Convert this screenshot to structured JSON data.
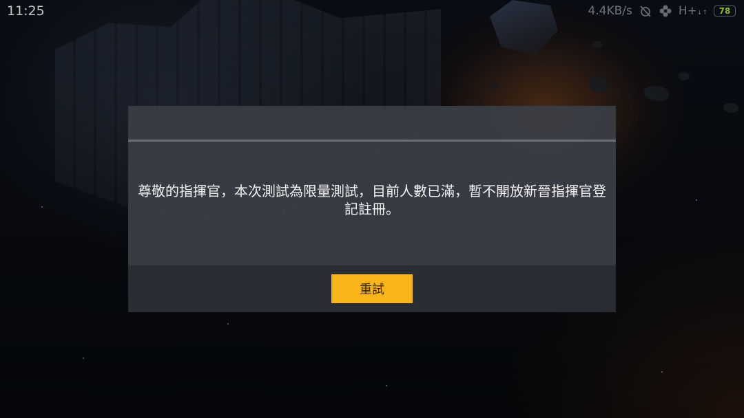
{
  "status_bar": {
    "time": "11:25",
    "network_speed": "4.4KB/s",
    "network_type": "H+",
    "network_type_sub": "↓↑",
    "battery": "78"
  },
  "dialog": {
    "message": "尊敬的指揮官，本次測試為限量測試，目前人數已滿，暫不開放新晉指揮官登記註冊。",
    "retry_label": "重試"
  },
  "icons": {
    "alarm_off": "alarm-off-icon",
    "flower": "flower-icon"
  },
  "colors": {
    "accent": "#f8b418",
    "battery": "#a6e22e"
  }
}
